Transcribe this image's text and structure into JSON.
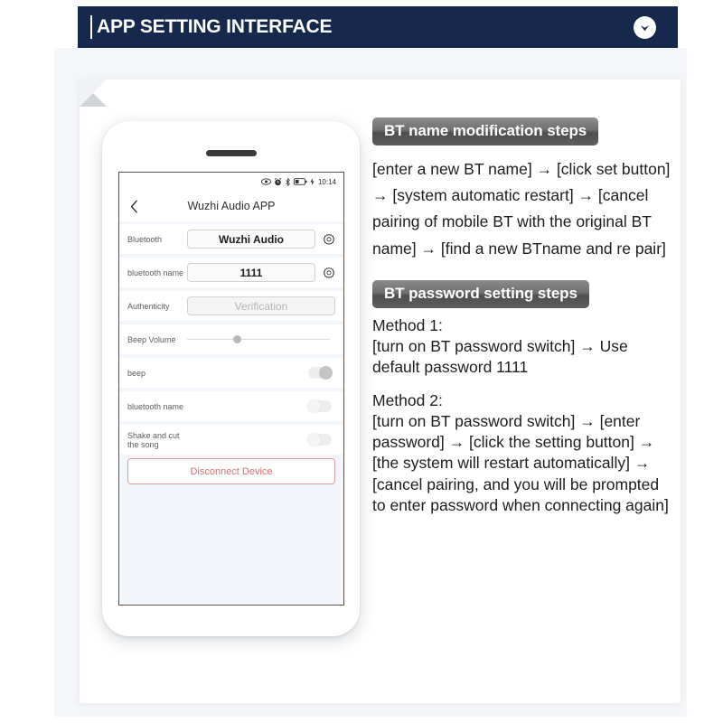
{
  "header": {
    "title": "APP SETTING INTERFACE",
    "chevron_icon": "chevron-down-icon",
    "bg_color": "#16284c"
  },
  "phone": {
    "status_bar": {
      "icons": [
        "eye-icon",
        "alarm-clock-icon",
        "bluetooth-icon",
        "battery-icon",
        "charging-bolt-icon"
      ],
      "time": "10:14"
    },
    "titlebar": {
      "back_icon": "chevron-left-icon",
      "title": "Wuzhi Audio APP"
    },
    "rows": [
      {
        "type": "field",
        "label": "Bluetooth",
        "value": "Wuzhi Audio",
        "disabled": false,
        "gear_icon": "gear-icon"
      },
      {
        "type": "field",
        "label": "bluetooth name",
        "value": "1111",
        "disabled": false,
        "gear_icon": "gear-icon"
      },
      {
        "type": "field",
        "label": "Authenticity",
        "value": "Verification",
        "disabled": true,
        "gear_icon": null
      },
      {
        "type": "slider",
        "label": "Beep Volume",
        "value": 31
      },
      {
        "type": "toggle",
        "label": "beep",
        "state": "on"
      },
      {
        "type": "toggle",
        "label": "bluetooth name",
        "state": "off"
      },
      {
        "type": "toggle",
        "label": "Shake and cut the song",
        "state": "off"
      }
    ],
    "disconnect_label": "Disconnect Device",
    "disconnect_color": "#d96d6d"
  },
  "instructions": {
    "section1": {
      "badge": "BT name modification steps",
      "body": "[enter a new BT name] → [click set button] → [system automatic restart] → [cancel pairing of mobile BT with the original BT name] → [find a new BTname and re pair]"
    },
    "section2": {
      "badge": "BT password setting steps",
      "method1": "Method 1:\n[turn on BT password switch] → Use default password 1111",
      "method2": "Method 2:\n[turn on BT password switch] → [enter password] → [click the setting button] → [the system will restart automatically] → [cancel pairing, and you will be prompted to enter password when connecting again]"
    }
  }
}
